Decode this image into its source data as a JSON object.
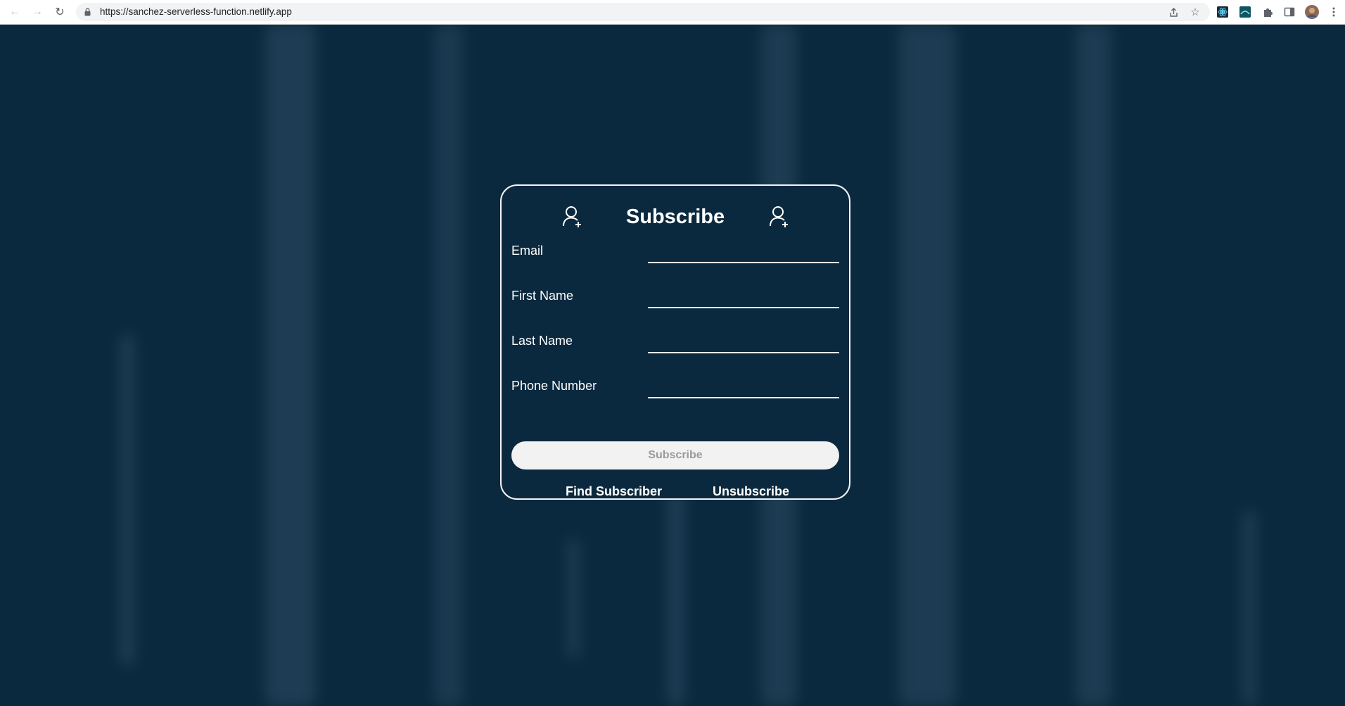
{
  "browser": {
    "url": "https://sanchez-serverless-function.netlify.app",
    "icons": {
      "back": "back-arrow-icon",
      "forward": "forward-arrow-icon",
      "reload": "reload-icon",
      "lock": "lock-icon",
      "share": "share-icon",
      "bookmark": "star-icon",
      "extensions": "puzzle-icon",
      "side_panel": "side-panel-icon",
      "profile": "avatar",
      "menu": "kebab-menu-icon"
    }
  },
  "form": {
    "title": "Subscribe",
    "header_icons": [
      "add-user-icon",
      "add-user-icon"
    ],
    "fields": [
      {
        "label": "Email",
        "value": ""
      },
      {
        "label": "First Name",
        "value": ""
      },
      {
        "label": "Last Name",
        "value": ""
      },
      {
        "label": "Phone Number",
        "value": ""
      }
    ],
    "submit_label": "Subscribe",
    "submit_disabled": true,
    "links": {
      "find": "Find Subscriber",
      "unsubscribe": "Unsubscribe"
    }
  },
  "colors": {
    "background": "#0b293e",
    "card_border": "#f4f4f4",
    "button_bg": "#f2f2f2",
    "button_text": "#9a9a9a"
  }
}
